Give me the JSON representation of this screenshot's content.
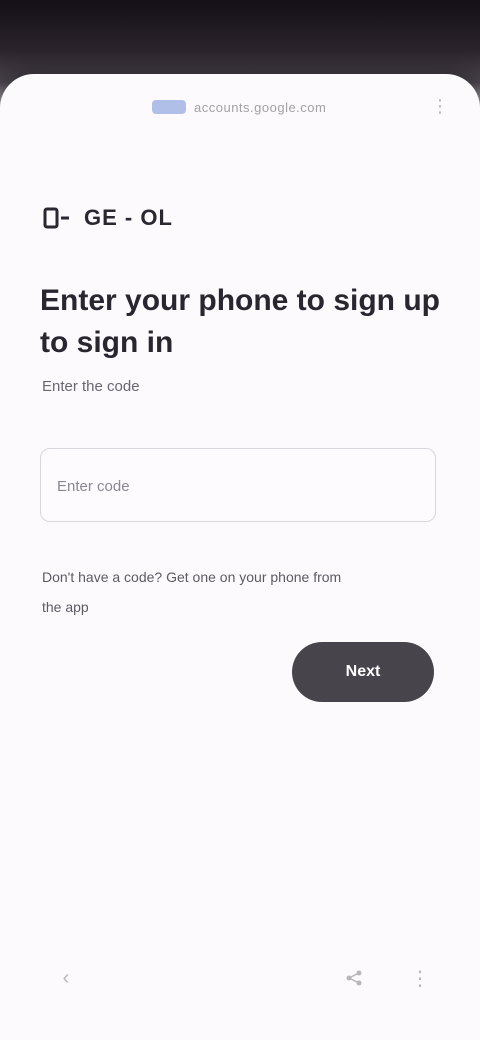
{
  "browser": {
    "url_text": "accounts.google.com",
    "tabs_icon": "tabs-icon",
    "menu_icon": "more-vert-icon"
  },
  "brand": {
    "icon": "phone-icon",
    "text": "GE - OL"
  },
  "main": {
    "heading": "Enter your phone to sign up to sign in",
    "subtext": "Enter the code",
    "code_field": {
      "placeholder": "Enter code",
      "value": ""
    },
    "helper_text": "Don't have a code? Get one on your phone from the app",
    "next_button": "Next"
  },
  "bottom_nav": {
    "left_icon": "back-arrow-icon",
    "right_icons": [
      "share-icon",
      "overflow-icon"
    ]
  },
  "colors": {
    "button": "#48444c",
    "sheet": "#fcfafd",
    "url_logo": "#6f8ed6"
  }
}
